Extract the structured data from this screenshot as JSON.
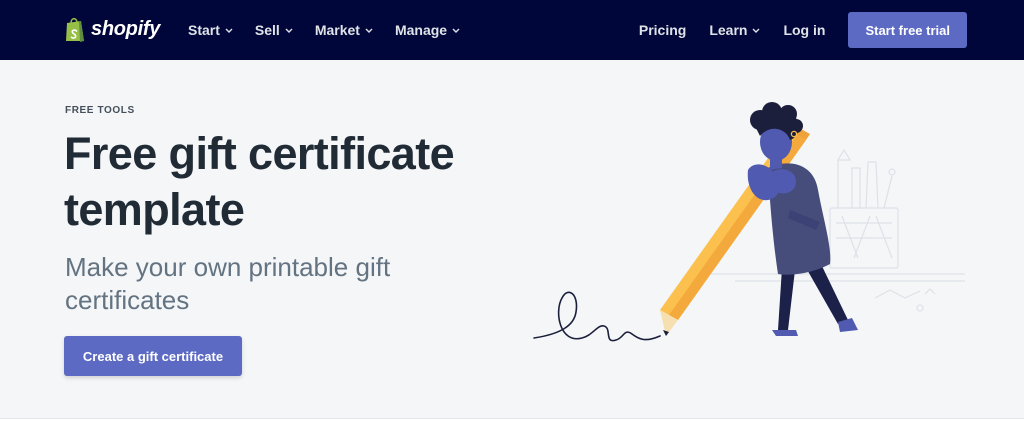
{
  "nav": {
    "logo_text": "shopify",
    "left_items": [
      {
        "label": "Start"
      },
      {
        "label": "Sell"
      },
      {
        "label": "Market"
      },
      {
        "label": "Manage"
      }
    ],
    "right_items": [
      {
        "label": "Pricing"
      },
      {
        "label": "Learn"
      },
      {
        "label": "Log in"
      }
    ],
    "cta_label": "Start free trial"
  },
  "hero": {
    "eyebrow": "FREE TOOLS",
    "title": "Free gift certificate template",
    "subtitle": "Make your own printable gift certificates",
    "cta_label": "Create a gift certificate"
  },
  "colors": {
    "nav_bg": "#000639",
    "accent": "#5c6ac4",
    "hero_bg": "#f4f6f8",
    "title": "#212b36",
    "subtitle": "#637381",
    "pencil": "#fbc04d",
    "figure": "#4f5ab0"
  },
  "icons": {
    "logo": "shopping-bag-icon",
    "dropdown": "chevron-down-icon"
  }
}
